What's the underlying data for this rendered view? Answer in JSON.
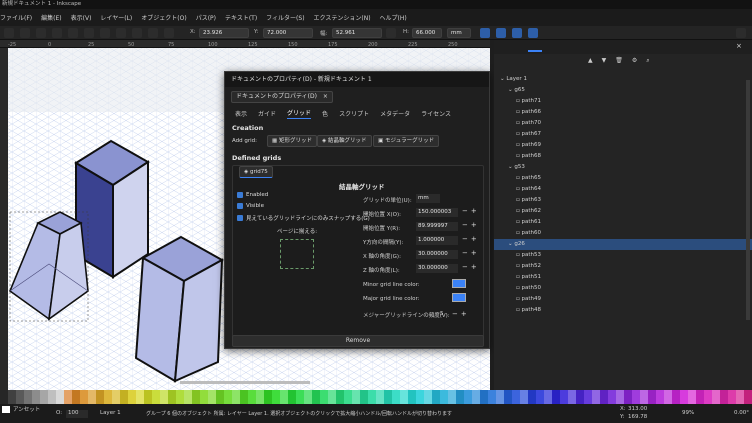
{
  "window": {
    "title": "新規ドキュメント 1 - Inkscape"
  },
  "menu": [
    "ファイル(F)",
    "編集(E)",
    "表示(V)",
    "レイヤー(L)",
    "オブジェクト(O)",
    "パス(P)",
    "テキスト(T)",
    "フィルター(S)",
    "エクステンション(N)",
    "ヘルプ(H)"
  ],
  "toolbar": {
    "x_label": "X:",
    "x": "23.926",
    "y_label": "Y:",
    "y": "72.000",
    "w_label": "幅:",
    "w": "52.961",
    "h_label": "H:",
    "h": "66.000",
    "unit": "mm"
  },
  "ruler": {
    "marks": [
      "-25",
      "0",
      "25",
      "50",
      "75",
      "100",
      "125",
      "150",
      "175",
      "200",
      "225",
      "250"
    ]
  },
  "dialog": {
    "title": "ドキュメントのプロパティ(D) - 新規ドキュメント 1",
    "tab_label": "ドキュメントのプロパティ(D)",
    "tab_close": "×",
    "subtabs": [
      "表示",
      "ガイド",
      "グリッド",
      "色",
      "スクリプト",
      "メタデータ",
      "ライセンス"
    ],
    "creation_heading": "Creation",
    "add_grid_label": "Add grid:",
    "grid_buttons": [
      "矩形グリッド",
      "結晶軸グリッド",
      "モジュラーグリッド"
    ],
    "defined_heading": "Defined grids",
    "grid_tab": "grid75",
    "section_title": "結晶軸グリッド",
    "enabled": "Enabled",
    "visible": "Visible",
    "snap_visible": "見えているグリッドラインにのみスナップする(G)",
    "per_page": "ページに揃える:",
    "props": [
      {
        "label": "グリッドの単位(U):",
        "value": "mm"
      },
      {
        "label": "開始位置 X(O):",
        "value": "150.000003"
      },
      {
        "label": "開始位置 Y(R):",
        "value": "89.999997"
      },
      {
        "label": "Y方向の間隔(Y):",
        "value": "1.000000"
      },
      {
        "label": "X 軸の角度(G):",
        "value": "30.000000"
      },
      {
        "label": "Z 軸の角度(L):",
        "value": "30.000000"
      },
      {
        "label": "Minor grid line color:",
        "value": ""
      },
      {
        "label": "Major grid line color:",
        "value": ""
      },
      {
        "label": "メジャーグリッドラインの頻度(V):",
        "value": "5"
      }
    ],
    "remove": "Remove"
  },
  "layers": [
    {
      "name": "Layer 1",
      "depth": 0,
      "selected": false
    },
    {
      "name": "g65",
      "depth": 1,
      "selected": false
    },
    {
      "name": "path71",
      "depth": 2,
      "selected": false
    },
    {
      "name": "path66",
      "depth": 2,
      "selected": false
    },
    {
      "name": "path70",
      "depth": 2,
      "selected": false
    },
    {
      "name": "path67",
      "depth": 2,
      "selected": false
    },
    {
      "name": "path69",
      "depth": 2,
      "selected": false
    },
    {
      "name": "path68",
      "depth": 2,
      "selected": false
    },
    {
      "name": "g53",
      "depth": 1,
      "selected": false
    },
    {
      "name": "path65",
      "depth": 2,
      "selected": false
    },
    {
      "name": "path64",
      "depth": 2,
      "selected": false
    },
    {
      "name": "path63",
      "depth": 2,
      "selected": false
    },
    {
      "name": "path62",
      "depth": 2,
      "selected": false
    },
    {
      "name": "path61",
      "depth": 2,
      "selected": false
    },
    {
      "name": "path60",
      "depth": 2,
      "selected": false
    },
    {
      "name": "g26",
      "depth": 1,
      "selected": true
    },
    {
      "name": "path53",
      "depth": 2,
      "selected": false
    },
    {
      "name": "path52",
      "depth": 2,
      "selected": false
    },
    {
      "name": "path51",
      "depth": 2,
      "selected": false
    },
    {
      "name": "path50",
      "depth": 2,
      "selected": false
    },
    {
      "name": "path49",
      "depth": 2,
      "selected": false
    },
    {
      "name": "path48",
      "depth": 2,
      "selected": false
    }
  ],
  "status": {
    "fill_label": "アンセット",
    "opacity_label": "O:",
    "opacity": "100",
    "layer": "Layer 1",
    "message": "グループ 6 個のオブジェクト 所属: レイヤー Layer 1. 選択オブジェクトのクリックで拡大縮小ハンドル/回転ハンドルが切り替わります",
    "x_label": "X:",
    "x": "313.00",
    "y_label": "Y:",
    "y": "169.78",
    "zoom": "99%",
    "rotation": "0.00°"
  },
  "colors": {
    "accent": "#3b82f6",
    "selection": "#2b4d7d",
    "shape_fill": "#b4bbe6",
    "shape_dark": "#3a4290"
  }
}
